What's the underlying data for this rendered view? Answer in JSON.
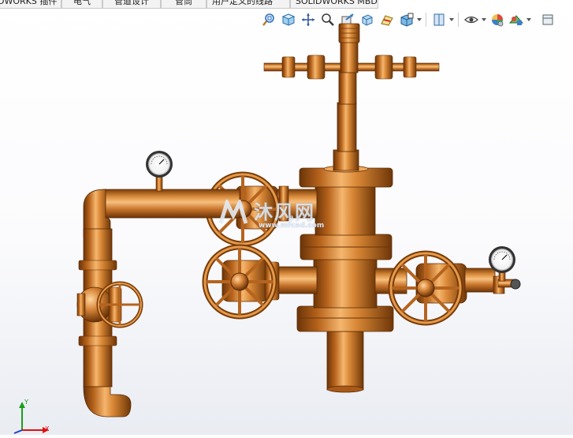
{
  "command_tabs": [
    {
      "label": "DWORKS 插件"
    },
    {
      "label": "电气"
    },
    {
      "label": "管道设计"
    },
    {
      "label": "管筒"
    },
    {
      "label": "用户定义的线路"
    },
    {
      "label": "SOLIDWORKS MBD"
    }
  ],
  "heads_up_toolbar": {
    "items": [
      {
        "icon": "zoom-to-fit-icon"
      },
      {
        "icon": "zoom-to-area-icon"
      },
      {
        "icon": "previous-view-icon"
      },
      {
        "icon": "section-view-icon"
      },
      {
        "icon": "dynamic-annotation-views-icon"
      },
      {
        "icon": "view-orientation-icon"
      },
      {
        "icon": "display-style-icon"
      },
      {
        "icon": "hide-show-items-icon"
      },
      {
        "icon": "edit-appearance-icon"
      },
      {
        "icon": "apply-scene-icon"
      },
      {
        "icon": "view-settings-icon"
      }
    ]
  },
  "watermark": {
    "text": "沐风网",
    "url": "www.mfcad.com"
  },
  "triad": {
    "x_label": "X",
    "y_label": "Y"
  },
  "colors": {
    "copper": "#c8762a",
    "copper_light": "#f2b36a",
    "copper_dark": "#6b3408",
    "axis_x": "#d11",
    "axis_y": "#1a9e1a",
    "axis_z": "#1a3fd1"
  }
}
